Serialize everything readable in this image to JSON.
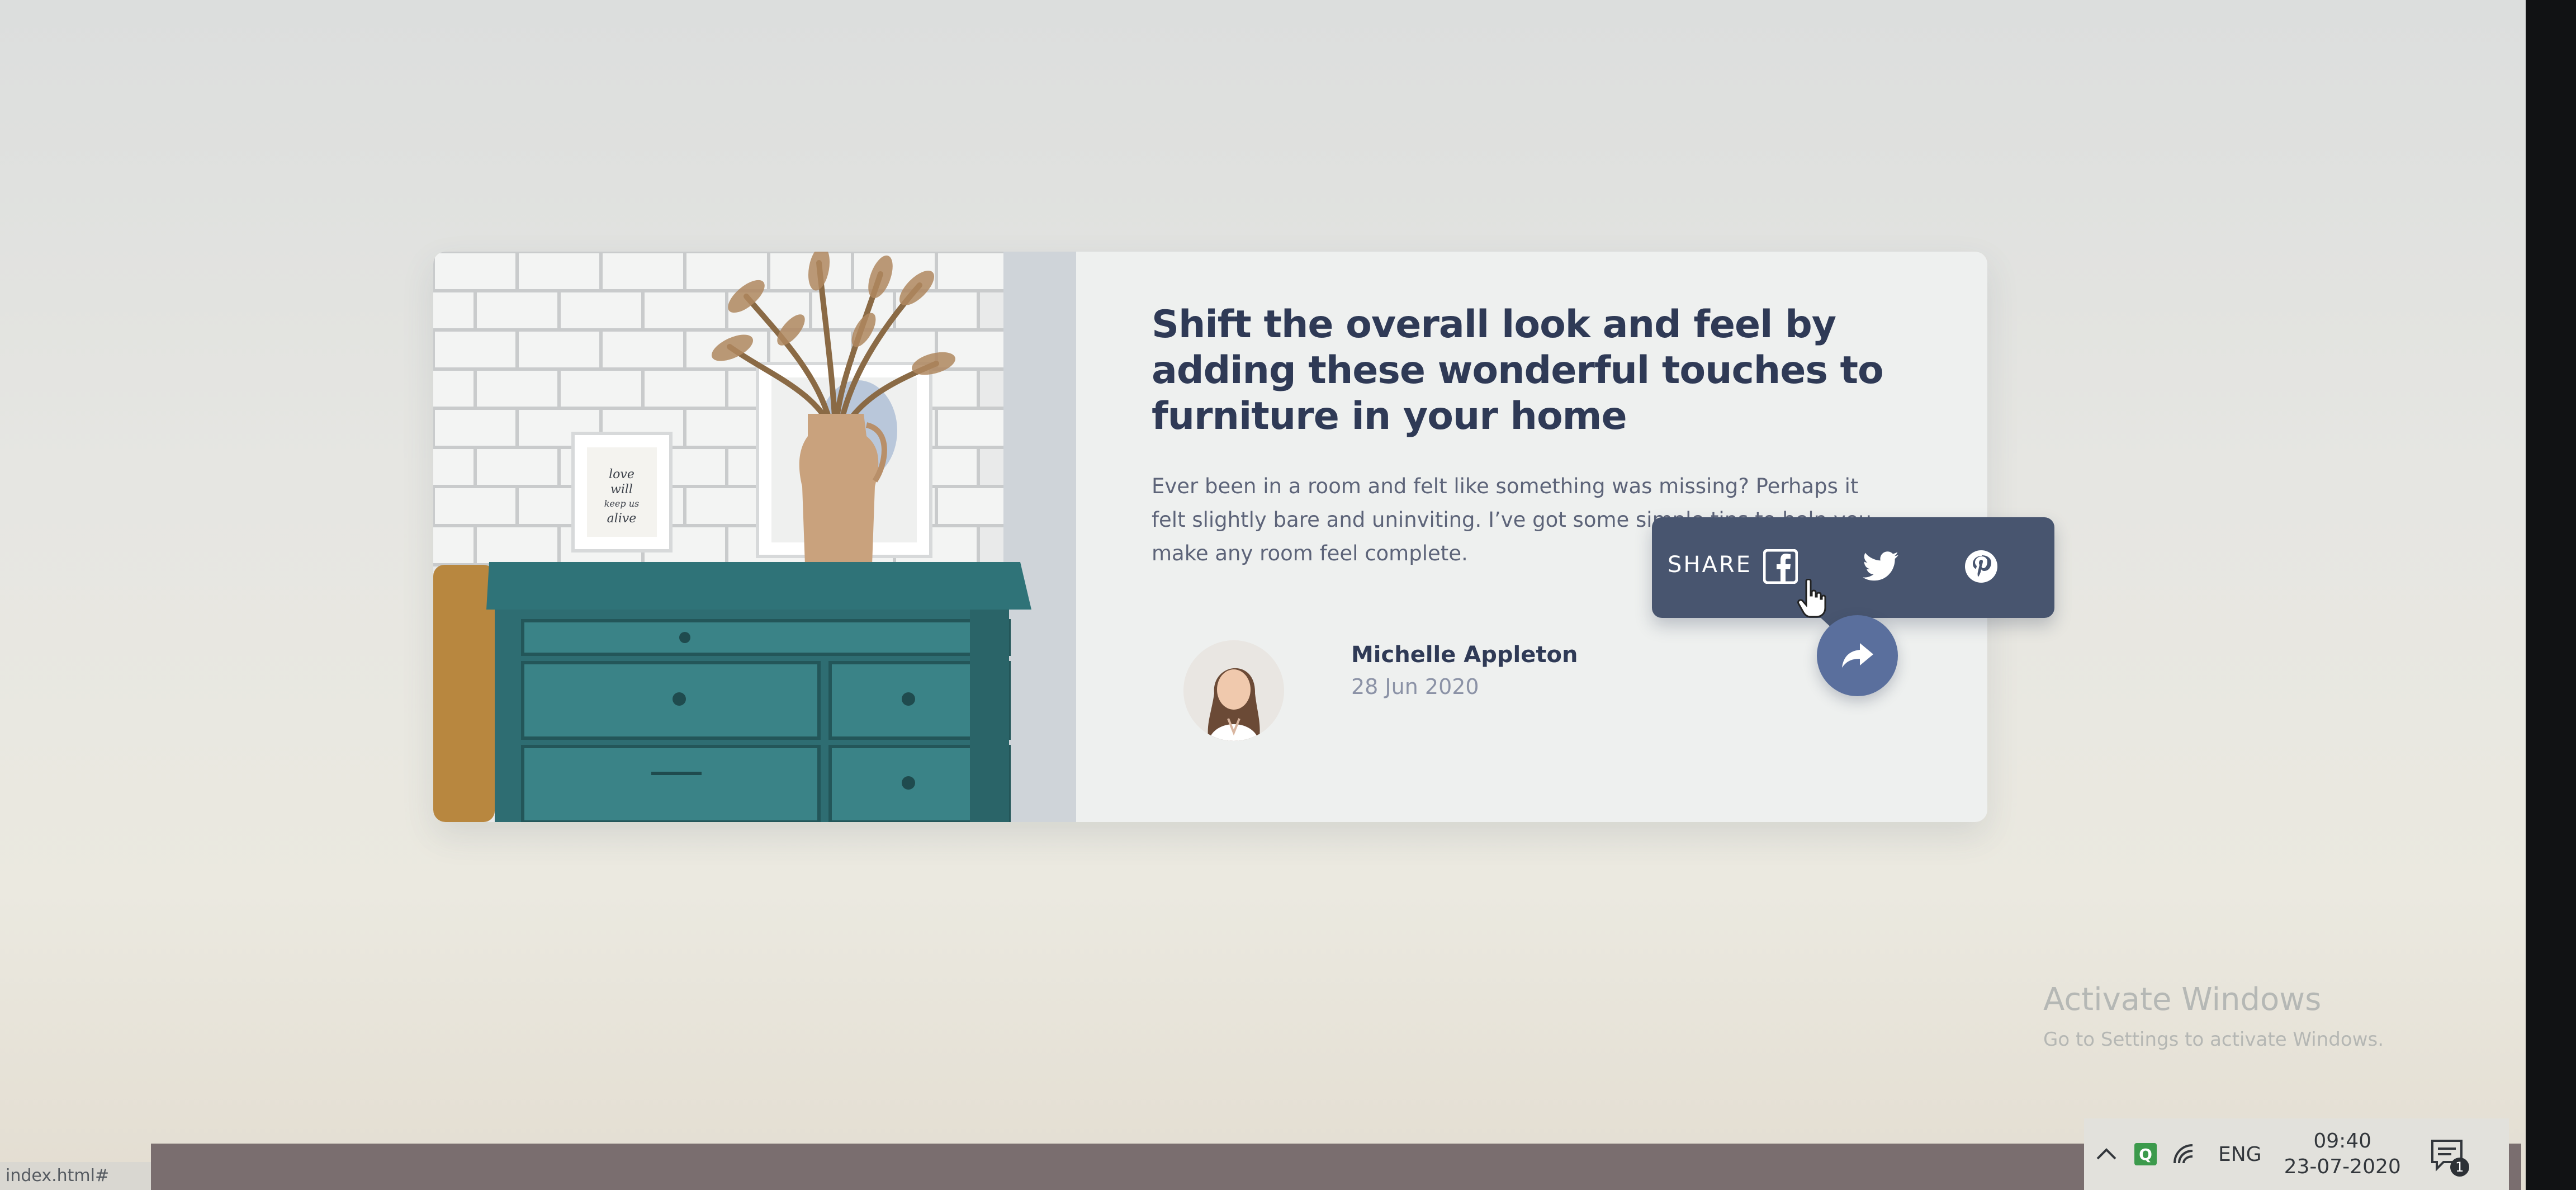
{
  "article": {
    "title": "Shift the overall look and feel by adding these wonderful touches to furniture in your home",
    "excerpt": "Ever been in a room and felt like something was missing? Perhaps it felt slightly bare and uninviting. I’ve got some simple tips to help you make any room feel complete.",
    "frame_text": "love will keep us alive",
    "author": {
      "name": "Michelle Appleton",
      "date": "28 Jun 2020"
    }
  },
  "share": {
    "label": "SHARE",
    "icons": [
      "facebook-icon",
      "twitter-icon",
      "pinterest-icon"
    ],
    "toggle_icon": "share-arrow-icon"
  },
  "watermark": {
    "title": "Activate Windows",
    "subtitle": "Go to Settings to activate Windows."
  },
  "status_bar": {
    "url": "index.html#"
  },
  "taskbar": {
    "language": "ENG",
    "time": "09:40",
    "date": "23-07-2020",
    "notification_count": "1"
  },
  "colors": {
    "title": "#2f3a56",
    "body_text": "#5d6479",
    "share_bar": "#48556f",
    "share_button": "#5a6f9d",
    "card_bg": "#eef0ef"
  }
}
